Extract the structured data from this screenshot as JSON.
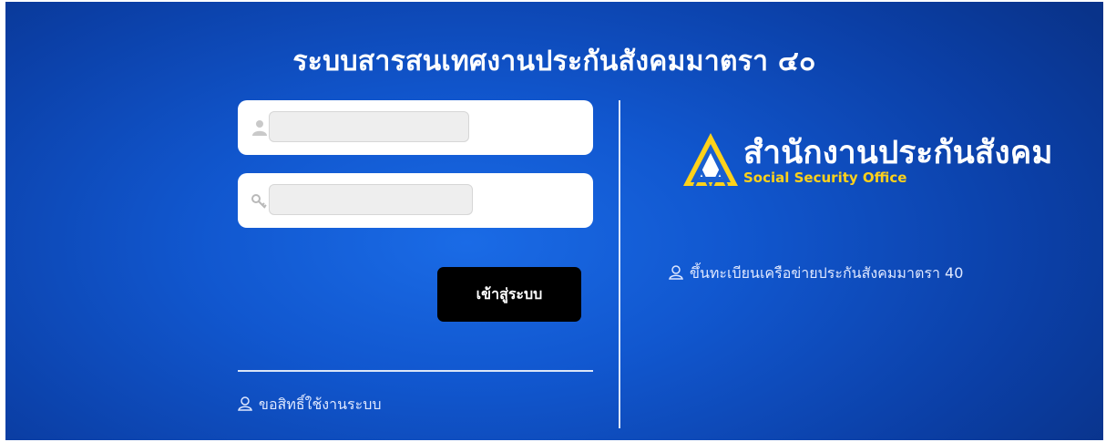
{
  "header": {
    "title": "ระบบสารสนเทศงานประกันสังคมมาตรา ๔๐"
  },
  "login_form": {
    "username": {
      "value": "",
      "icon": "user-icon"
    },
    "password": {
      "value": "",
      "icon": "key-icon"
    },
    "submit_label": "เข้าสู่ระบบ"
  },
  "links": {
    "request_access": "ขอสิทธิ์ใช้งานระบบ",
    "register_network": "ขึ้นทะเบียนเครือข่ายประกันสังคมมาตรา 40"
  },
  "logo": {
    "name_th": "สำนักงานประกันสังคม",
    "name_en": "Social Security Office"
  },
  "colors": {
    "background": "#1157cf",
    "button": "#000000",
    "logo_accent": "#ffd21a"
  }
}
